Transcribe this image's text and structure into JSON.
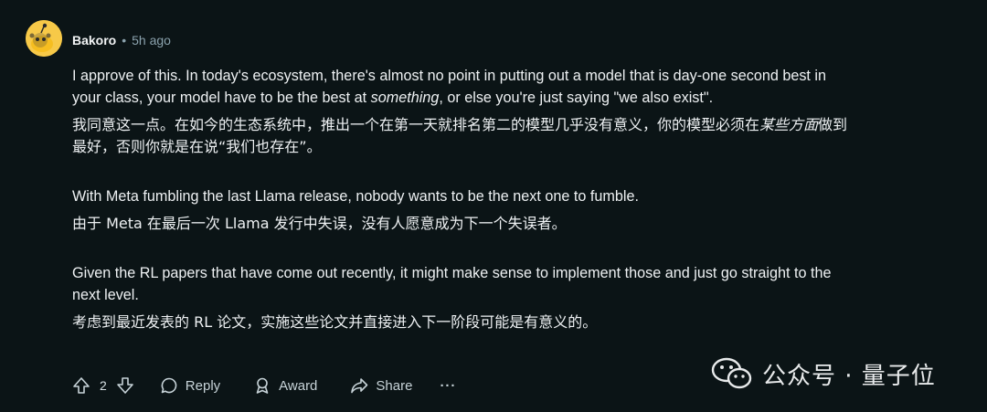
{
  "comment": {
    "username": "Bakoro",
    "separator": "•",
    "time": "5h ago",
    "paragraphs": {
      "en1_a": "I approve of this. In today's ecosystem, there's almost no point in putting out a model that is day-one second best in your class, your model have to be the best at ",
      "en1_em": "something",
      "en1_b": ", or else you're just saying \"we also exist\".",
      "zh1_a": "我同意这一点。在如今的生态系统中，推出一个在第一天就排名第二的模型几乎没有意义，你的模型必须在",
      "zh1_em": "某些方面",
      "zh1_b": "做到最好，否则你就是在说“我们也存在”。",
      "en2": "With Meta fumbling the last Llama release, nobody wants to be the next one to fumble.",
      "zh2": "由于 Meta 在最后一次 Llama 发行中失误，没有人愿意成为下一个失误者。",
      "en3": "Given the RL papers that have come out recently, it might make sense to implement those and just go straight to the next level.",
      "zh3": "考虑到最近发表的 RL 论文，实施这些论文并直接进入下一阶段可能是有意义的。"
    }
  },
  "actions": {
    "upvote_icon": "upvote-arrow-icon",
    "vote_count": "2",
    "downvote_icon": "downvote-arrow-icon",
    "reply_label": "Reply",
    "award_label": "Award",
    "share_label": "Share",
    "more_label": "···"
  },
  "watermark": {
    "text": "公众号 · 量子位",
    "icon": "wechat-icon"
  },
  "colors": {
    "background": "#0b1416",
    "avatar": "#f7c948",
    "text": "#eef1f3",
    "muted": "#8ba2ad"
  }
}
